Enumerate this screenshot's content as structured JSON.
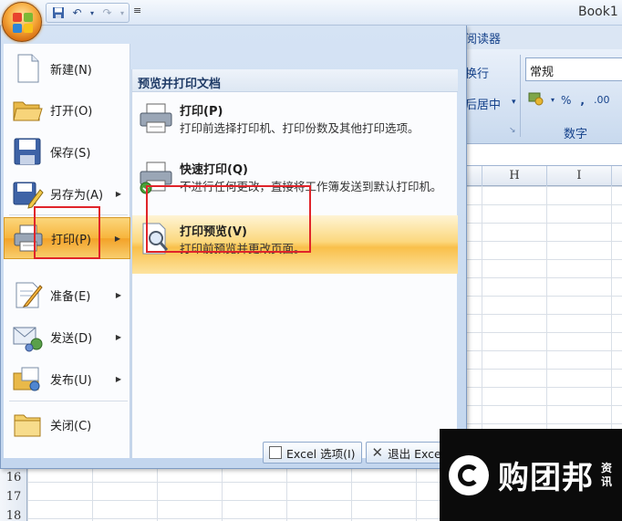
{
  "window": {
    "title": "Book1 -"
  },
  "qat": {
    "save_icon": "save-icon",
    "undo_icon": "undo-icon",
    "redo_icon": "redo-icon",
    "customize_icon": "equal-icon"
  },
  "ribbon": {
    "tab_partial": "阅读器",
    "wrap_text": "换行",
    "merge_center": "后居中",
    "number_format": "常规",
    "percent": "%",
    "comma": ",",
    "decimal": ".00",
    "group_label": "数字"
  },
  "sheet": {
    "columns": [
      "H",
      "I"
    ],
    "rows": [
      "16",
      "17",
      "18"
    ]
  },
  "office_menu": {
    "items": [
      {
        "label": "新建(N)",
        "icon": "new-document-icon",
        "has_arrow": false
      },
      {
        "label": "打开(O)",
        "icon": "open-folder-icon",
        "has_arrow": false
      },
      {
        "label": "保存(S)",
        "icon": "save-icon",
        "has_arrow": false
      },
      {
        "label": "另存为(A)",
        "icon": "save-as-icon",
        "has_arrow": true
      },
      {
        "label": "打印(P)",
        "icon": "printer-icon",
        "has_arrow": true
      },
      {
        "label": "准备(E)",
        "icon": "prepare-icon",
        "has_arrow": true
      },
      {
        "label": "发送(D)",
        "icon": "send-icon",
        "has_arrow": true
      },
      {
        "label": "发布(U)",
        "icon": "publish-icon",
        "has_arrow": true
      },
      {
        "label": "关闭(C)",
        "icon": "close-folder-icon",
        "has_arrow": false
      }
    ],
    "submenu": {
      "header": "预览并打印文档",
      "items": [
        {
          "title": "打印(P)",
          "desc": "打印前选择打印机、打印份数及其他打印选项。",
          "icon": "printer-icon"
        },
        {
          "title": "快速打印(Q)",
          "desc": "不进行任何更改，直接将工作簿发送到默认打印机。",
          "icon": "quick-print-icon"
        },
        {
          "title": "打印预览(V)",
          "desc": "打印前预览并更改页面。",
          "icon": "print-preview-icon"
        }
      ]
    },
    "footer": {
      "options_label": "Excel 选项(I)",
      "exit_label": "退出 Excel"
    }
  },
  "watermark": {
    "brand": "购团邦",
    "side_text": "资讯"
  }
}
